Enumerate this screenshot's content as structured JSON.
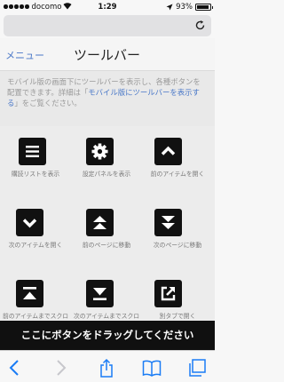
{
  "status_bar": {
    "carrier": "docomo",
    "time": "1:29",
    "battery_percent": "93%",
    "battery_level": 0.93,
    "signal_bars": 5
  },
  "header": {
    "menu_link": "メニュー",
    "title": "ツールバー"
  },
  "description": {
    "text1": "モバイル版の画面下にツールバーを表示し、各種ボタンを配置できます。詳細は「",
    "link": "モバイル版にツールバーを表示する",
    "text2": "」をご覧ください。"
  },
  "tools": [
    {
      "label": "購読リストを表示",
      "icon": "list-icon"
    },
    {
      "label": "設定パネルを表示",
      "icon": "gear-icon"
    },
    {
      "label": "前のアイテムを開く",
      "icon": "chevron-up-icon"
    },
    {
      "label": "次のアイテムを開く",
      "icon": "chevron-down-icon"
    },
    {
      "label": "前のページに移動",
      "icon": "double-chevron-up-icon"
    },
    {
      "label": "次のページに移動",
      "icon": "double-chevron-down-icon"
    },
    {
      "label": "前のアイテムまでスクロール",
      "icon": "scroll-up-icon"
    },
    {
      "label": "次のアイテムまでスクロール",
      "icon": "scroll-down-icon"
    },
    {
      "label": "別タブで開く",
      "icon": "external-link-icon"
    }
  ],
  "drag_banner": "ここにボタンをドラッグしてください",
  "browser_toolbar": {
    "buttons": [
      "back-icon",
      "forward-icon",
      "share-icon",
      "bookmarks-icon",
      "tabs-icon"
    ]
  },
  "colors": {
    "link": "#4a78c8",
    "button_bg": "#111111",
    "accent": "#1a7cf5"
  }
}
